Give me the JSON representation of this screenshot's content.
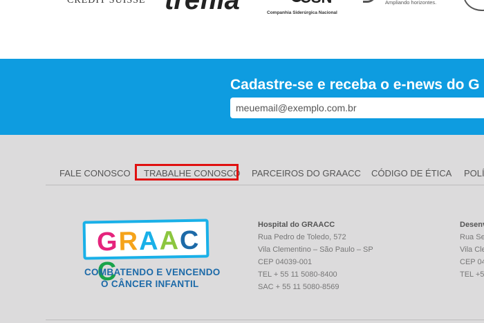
{
  "partners": {
    "logo1": "CREDIT SUISSE",
    "logo2": "trefila",
    "logo3_mark": "CSN",
    "logo3_tagline": "Companhia Siderúrgica Nacional",
    "logo4_tagline": "Ampliando horizontes."
  },
  "newsletter": {
    "title": "Cadastre-se e receba o e-news do G",
    "email_placeholder": "meuemail@exemplo.com.br",
    "bg_color": "#0e9ce0"
  },
  "footer_nav": {
    "items": [
      {
        "label": "FALE CONOSCO"
      },
      {
        "label": "TRABALHE CONOSCO"
      },
      {
        "label": "PARCEIROS DO GRAACC"
      },
      {
        "label": "CÓDIGO DE ÉTICA"
      },
      {
        "label": "POLÍ"
      }
    ],
    "highlight_color": "#e01010"
  },
  "graacc_logo": {
    "letters": [
      "G",
      "R",
      "A",
      "A",
      "C",
      "C"
    ],
    "letter_colors": [
      "#e5247c",
      "#f5a31a",
      "#19b0e8",
      "#8cc63f",
      "#1d6aa8",
      "#19a34a"
    ],
    "slogan_line1": "COMBATENDO E VENCENDO",
    "slogan_line2": "O CÂNCER INFANTIL"
  },
  "address1": {
    "title": "Hospital do GRAACC",
    "line1": "Rua Pedro de Toledo, 572",
    "line2": "Vila Clementino – São Paulo – SP",
    "line3": "CEP 04039-001",
    "line4": "TEL + 55 11 5080-8400",
    "line5": "SAC + 55 11 5080-8569"
  },
  "address2": {
    "title": "Desenv",
    "line1": "Rua Se",
    "line2": "Vila Cle",
    "line3": "CEP 04",
    "line4": "TEL +5"
  }
}
